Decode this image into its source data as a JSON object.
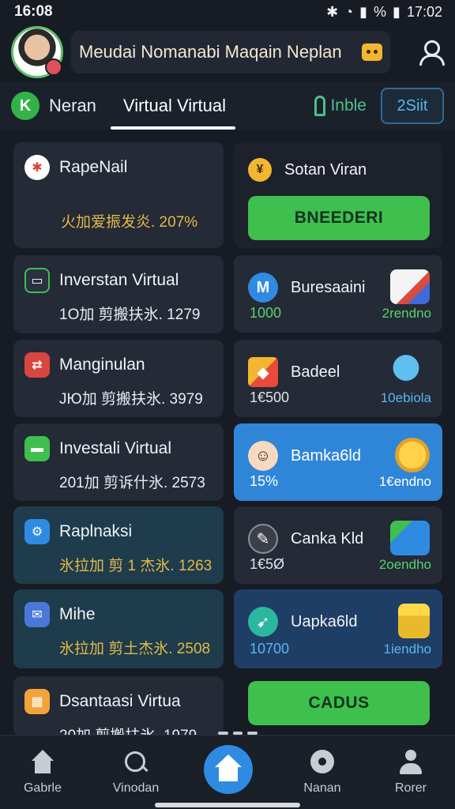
{
  "status": {
    "time_left": "16:08",
    "time_right": "17:02",
    "battery": "%"
  },
  "header": {
    "title": "Meudai Nomanabi  Maqain Neplan"
  },
  "tabs": {
    "brand_label": "Neran",
    "active_label": "Virtual  Virtual",
    "table_label": "Inble",
    "button_label": "2Siit"
  },
  "left_cards": [
    {
      "title": "RapeNail",
      "value": "火加爱振发炎. 207%",
      "value_color": "#e4b84b",
      "icon_color": "#ffffff",
      "icon_glyph": "✱"
    },
    {
      "title": "Inverstan Virtual",
      "value": "1О加 剪搬扶氷. 1279",
      "value_color": "#e8ebef",
      "icon_color": "#2a3240",
      "icon_glyph": "▭"
    },
    {
      "title": "Manginulan",
      "value": "ЈЮ加 剪搬扶氷. 3979",
      "value_color": "#e8ebef",
      "icon_color": "#d9453f",
      "icon_glyph": "⇄"
    },
    {
      "title": "Investali Virtual",
      "value": "201加 剪诉什氷. 2573",
      "value_color": "#e8ebef",
      "icon_color": "#3fbf4e",
      "icon_glyph": "▬"
    },
    {
      "title": "Raplnaksi",
      "value": "氷拉加 剪 1 杰氷. 1263",
      "value_color": "#e4b84b",
      "icon_color": "#2f8be2",
      "icon_glyph": "⚙"
    },
    {
      "title": "Mihe",
      "value": "氷拉加 剪土杰氷. 2508",
      "value_color": "#e4b84b",
      "icon_color": "#4a78d8",
      "icon_glyph": "✉"
    },
    {
      "title": "Dsantaasi Virtua",
      "value": "20加 剪搬扶氷. 1979",
      "value_color": "#e8ebef",
      "icon_color": "#f2a33a",
      "icon_glyph": "▦"
    }
  ],
  "right_top": {
    "title": "Sotan Viran",
    "button_label": "BNEEDERI"
  },
  "right_cards": [
    {
      "title": "Buresaaini",
      "number": "1000",
      "sub": "2rendno",
      "sub_color": "#5cd070",
      "icon_color": "#2f8be2",
      "icon_glyph": "M",
      "art_color": "#d94b3f"
    },
    {
      "title": "Badeel",
      "number": "1€500",
      "sub": "10ebiola",
      "sub_color": "#58b6f0",
      "icon_color": "#e84b3a",
      "icon_glyph": "◆",
      "art_color": "#3fa6e8"
    },
    {
      "title": "Bamka6ld",
      "number": "15%",
      "sub": "1€endno",
      "sub_color": "#ffffff",
      "icon_color": "#f6c9a6",
      "icon_glyph": "☺",
      "art_color": "#f2b631"
    },
    {
      "title": "Canka Kld",
      "number": "1€5Ø",
      "sub": "2oendho",
      "sub_color": "#5cd070",
      "icon_color": "#3a3f48",
      "icon_glyph": "✎",
      "art_color": "#2f8be2"
    },
    {
      "title": "Uapka6ld",
      "number": "10700",
      "sub": "1iendho",
      "sub_color": "#58b6f0",
      "icon_color": "#2bb7a0",
      "icon_glyph": "➹",
      "art_color": "#f2c531"
    }
  ],
  "right_bottom": {
    "button_label": "CADUS"
  },
  "bottom_nav": [
    {
      "label": "Gabrle"
    },
    {
      "label": "Vinodan"
    },
    {
      "label": "Nanan"
    },
    {
      "label": "Rorer"
    }
  ]
}
